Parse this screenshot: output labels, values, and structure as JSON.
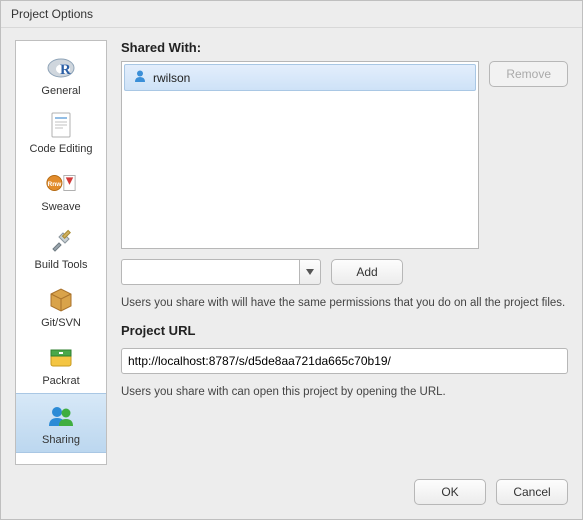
{
  "dialog_title": "Project Options",
  "sidebar": {
    "items": [
      {
        "label": "General"
      },
      {
        "label": "Code Editing"
      },
      {
        "label": "Sweave"
      },
      {
        "label": "Build Tools"
      },
      {
        "label": "Git/SVN"
      },
      {
        "label": "Packrat"
      },
      {
        "label": "Sharing"
      }
    ],
    "selected_index": 6
  },
  "sharing": {
    "shared_with_label": "Shared With:",
    "users": [
      {
        "name": "rwilson"
      }
    ],
    "remove_label": "Remove",
    "remove_enabled": false,
    "add_input_value": "",
    "add_label": "Add",
    "permissions_hint": "Users you share with will have the same permissions that you do on all the project files.",
    "project_url_label": "Project URL",
    "project_url": "http://localhost:8787/s/d5de8aa721da665c70b19/",
    "url_hint": "Users you share with can open this project by opening the URL."
  },
  "footer": {
    "ok_label": "OK",
    "cancel_label": "Cancel"
  }
}
